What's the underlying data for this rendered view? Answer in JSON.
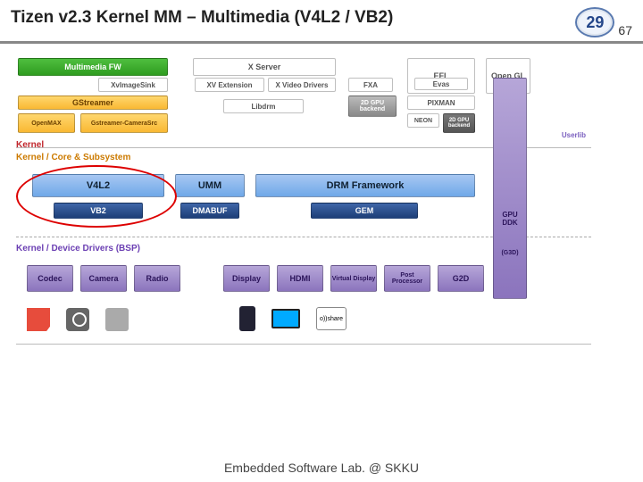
{
  "header": {
    "title": "Tizen v2.3 Kernel MM – Multimedia (V4L2 / VB2)",
    "page_current": "29",
    "page_total": "67"
  },
  "top_row": {
    "mmfw": "Multimedia FW",
    "xserver": "X Server",
    "efl": "EFL",
    "opengl": "Open GL"
  },
  "row2": {
    "xvimagesink": "XvImageSink",
    "xvext": "XV Extension",
    "xvd": "X Video Drivers",
    "fxa": "FXA",
    "evas": "Evas"
  },
  "row3": {
    "gstreamer": "GStreamer",
    "libdrm": "Libdrm",
    "gpu2d": "2D GPU backend",
    "pixman": "PIXMAN"
  },
  "row4": {
    "openmax": "OpenMAX",
    "gstcam": "Gstreamer-CameraSrc",
    "neon": "NEON",
    "gpu2d_user": "2D GPU backend"
  },
  "sections": {
    "kernel": "Kernel",
    "core": "Kernel / Core & Subsystem",
    "bsp": "Kernel / Device Drivers (BSP)",
    "userlib": "Userlib"
  },
  "core": {
    "v4l2": "V4L2",
    "umm": "UMM",
    "drmfw": "DRM Framework",
    "vb2": "VB2",
    "dmabuf": "DMABUF",
    "gem": "GEM"
  },
  "side": {
    "gpuddk": "GPU DDK",
    "g3d": "(G3D)"
  },
  "bsp": {
    "codec": "Codec",
    "camera": "Camera",
    "radio": "Radio",
    "display": "Display",
    "hdmi": "HDMI",
    "vdisplay": "Virtual Display",
    "postproc": "Post Processor",
    "g2d": "G2D"
  },
  "icons": {
    "share": "o))share"
  },
  "footer": "Embedded Software Lab. @ SKKU"
}
